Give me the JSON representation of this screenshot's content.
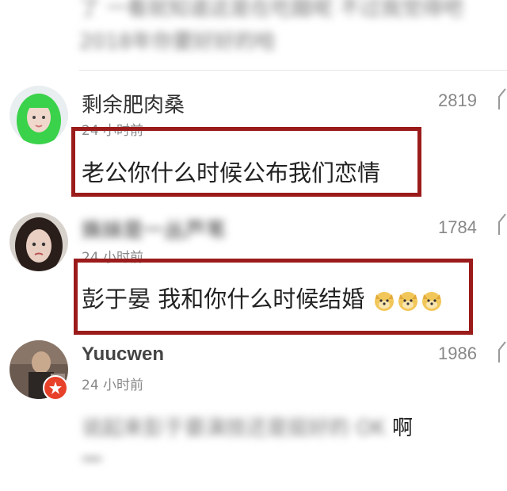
{
  "top_blurred": {
    "line1": "了 一看就知道这是在吃醋呢 不过我觉得吧",
    "line2": "2018年你要好好的哈"
  },
  "comments": [
    {
      "username": "剩余肥肉桑",
      "time": "24 小时前",
      "likes": "2819",
      "text": "老公你什么时候公布我们恋情",
      "avatar_colors": [
        "#3ad24a",
        "#f0d8cc"
      ]
    },
    {
      "username": "姝妹是一丛芦苇",
      "time": "24 小时前",
      "likes": "1784",
      "text": "彭于晏 我和你什么时候结婚",
      "avatar_colors": [
        "#2a1e1a",
        "#e8cfc2"
      ]
    },
    {
      "username": "Yuucwen",
      "time": "24 小时前",
      "likes": "1986",
      "text_blurred": "说起来彭于晏演技还是挺好的 OK",
      "text_end": "啊",
      "text_line2_blurred": "一",
      "avatar_colors": [
        "#6b5a50",
        "#c9a98e"
      ]
    }
  ],
  "colors": {
    "highlight_border": "#9b1b1b",
    "badge": "#e8412a"
  }
}
